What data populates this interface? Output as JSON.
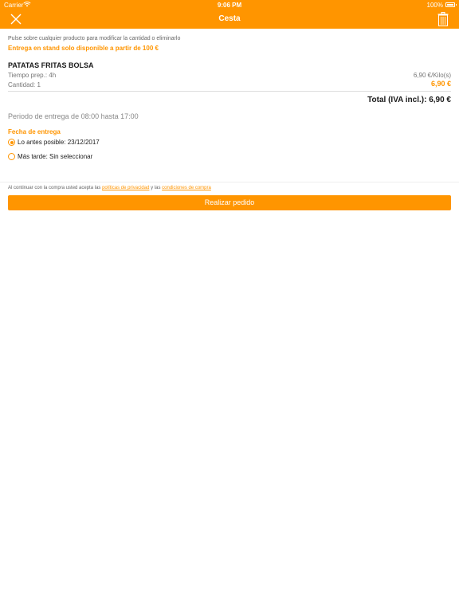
{
  "status_bar": {
    "carrier": "Carrier",
    "time": "9:06 PM",
    "battery": "100%"
  },
  "nav": {
    "title": "Cesta",
    "close_icon": "close-icon",
    "trash_icon": "trash-icon"
  },
  "info": {
    "hint": "Pulse sobre cualquier producto para modificar la cantidad o eliminarlo",
    "stand_notice": "Entrega en stand solo disponible a partir de 100 €"
  },
  "product": {
    "name": "PATATAS FRITAS BOLSA",
    "prep_time": "Tiempo prep.: 4h",
    "quantity": "Cantidad: 1",
    "unit_price": "6,90 €/Kilo(s)",
    "price": "6,90 €"
  },
  "summary": {
    "total": "Total (IVA incl.): 6,90 €",
    "period": "Periodo de entrega de 08:00 hasta 17:00"
  },
  "delivery": {
    "heading": "Fecha de entrega",
    "options": [
      {
        "label": "Lo antes posible: 23/12/2017",
        "selected": true
      },
      {
        "label": "Más tarde: Sin seleccionar",
        "selected": false
      }
    ]
  },
  "legal": {
    "prefix": "Al continuar con la compra usted acepta las",
    "privacy_link": "políticas de privacidad",
    "middle": "y las",
    "terms_link": "condiciones de compra"
  },
  "cta": {
    "label": "Realizar pedido"
  },
  "colors": {
    "accent": "#ff9500"
  }
}
